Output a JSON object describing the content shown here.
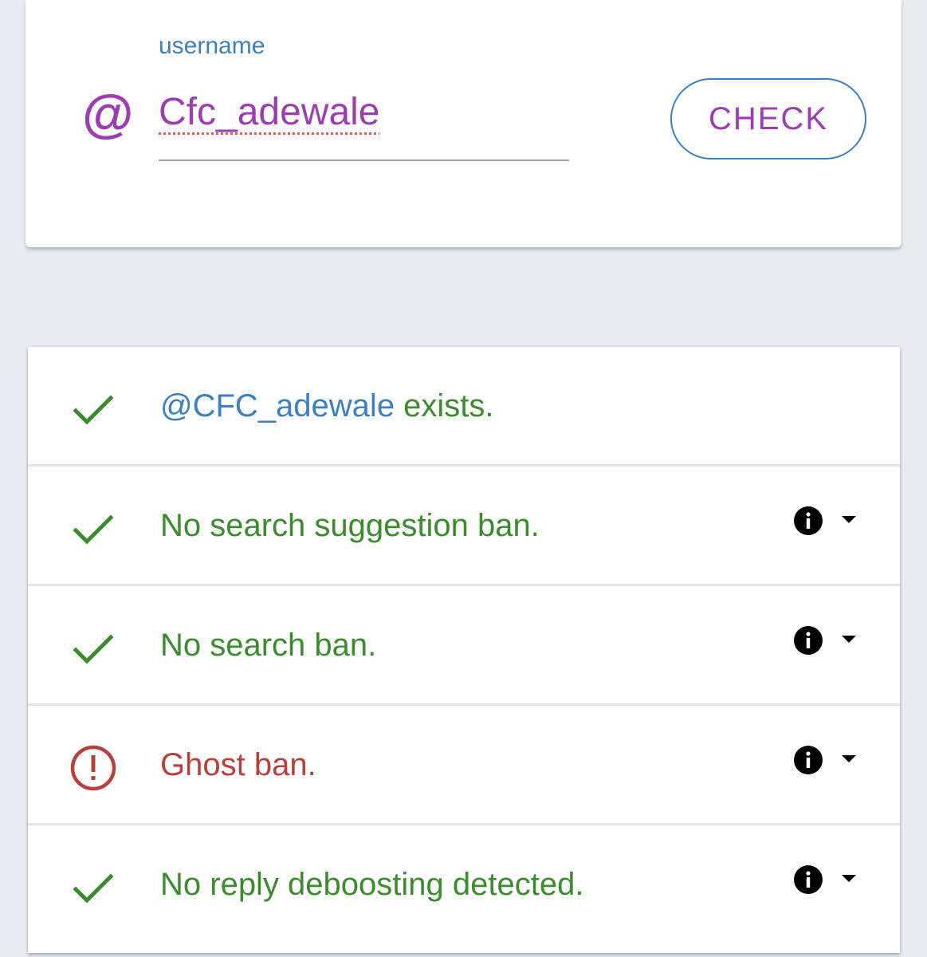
{
  "input": {
    "label": "username",
    "prefix": "@",
    "value": "Cfc_adewale",
    "button_label": "CHECK"
  },
  "results": [
    {
      "status": "ok",
      "handle": "@CFC_adewale",
      "text": " exists.",
      "has_details": false
    },
    {
      "status": "ok",
      "text": "No search suggestion ban.",
      "has_details": true
    },
    {
      "status": "ok",
      "text": "No search ban.",
      "has_details": true
    },
    {
      "status": "bad",
      "text": "Ghost ban.",
      "has_details": true
    },
    {
      "status": "ok",
      "text": "No reply deboosting detected.",
      "has_details": true
    }
  ],
  "icons": {
    "ok": "check-icon",
    "bad": "alert-circle-icon",
    "details": "info-icon",
    "expand": "caret-down-icon"
  },
  "colors": {
    "ok": "#3c8b2e",
    "bad": "#b6403b",
    "accent": "#3d7fbf",
    "input_text": "#9b3fb0"
  }
}
